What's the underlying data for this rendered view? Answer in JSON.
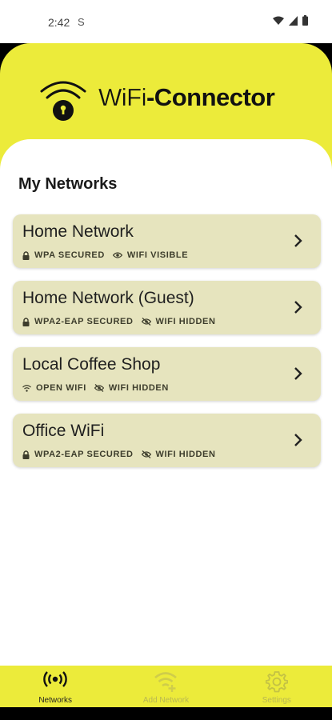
{
  "status": {
    "time": "2:42",
    "sim_icon": "S"
  },
  "header": {
    "logo_light": "WiFi",
    "logo_bold": "-Connector"
  },
  "section_title": "My Networks",
  "networks": [
    {
      "name": "Home Network",
      "security": "WPA SECURED",
      "visibility": "WIFI VISIBLE",
      "security_icon": "lock-icon",
      "visibility_icon": "eye-icon"
    },
    {
      "name": "Home Network (Guest)",
      "security": "WPA2-EAP SECURED",
      "visibility": "WIFI HIDDEN",
      "security_icon": "lock-icon",
      "visibility_icon": "eye-off-icon"
    },
    {
      "name": "Local Coffee Shop",
      "security": "OPEN WIFI",
      "visibility": "WIFI HIDDEN",
      "security_icon": "wifi-icon",
      "visibility_icon": "eye-off-icon"
    },
    {
      "name": "Office WiFi",
      "security": "WPA2-EAP SECURED",
      "visibility": "WIFI HIDDEN",
      "security_icon": "lock-icon",
      "visibility_icon": "eye-off-icon"
    }
  ],
  "nav": [
    {
      "label": "Networks",
      "icon": "broadcast-icon",
      "active": true
    },
    {
      "label": "Add Network",
      "icon": "wifi-add-icon",
      "disabled": true
    },
    {
      "label": "Settings",
      "icon": "gear-icon",
      "disabled": true
    }
  ],
  "colors": {
    "accent": "#ECEB3A",
    "card": "#E6E4BE"
  }
}
